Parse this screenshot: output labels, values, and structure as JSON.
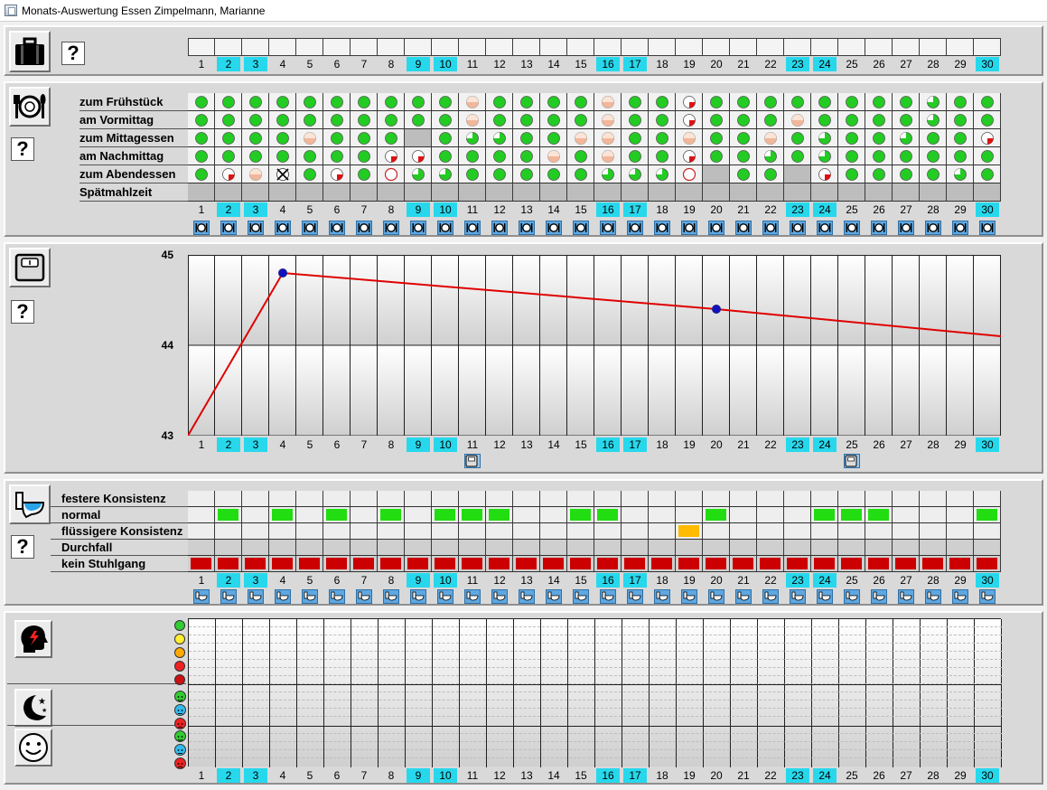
{
  "window": {
    "title": "Monats-Auswertung Essen Zimpelmann, Marianne"
  },
  "help_label": "?",
  "days": [
    1,
    2,
    3,
    4,
    5,
    6,
    7,
    8,
    9,
    10,
    11,
    12,
    13,
    14,
    15,
    16,
    17,
    18,
    19,
    20,
    21,
    22,
    23,
    24,
    25,
    26,
    27,
    28,
    29,
    30
  ],
  "highlight_days": [
    2,
    3,
    9,
    10,
    16,
    17,
    23,
    24,
    30
  ],
  "meals": {
    "rows": [
      "zum Frühstück",
      "am Vormittag",
      "zum Mittagessen",
      "am Nachmittag",
      "zum Abendessen",
      "Spätmahlzeit"
    ],
    "legend": {
      "G": "full",
      "H": "half",
      "Q": "quarter eaten",
      "R": "quarter",
      "O": "none",
      "X": "refused",
      "-": "empty"
    },
    "grid": [
      [
        "G",
        "G",
        "G",
        "G",
        "G",
        "G",
        "G",
        "G",
        "G",
        "G",
        "H",
        "G",
        "G",
        "G",
        "G",
        "H",
        "G",
        "G",
        "R",
        "G",
        "G",
        "G",
        "G",
        "G",
        "G",
        "G",
        "G",
        "T",
        "G",
        "G"
      ],
      [
        "G",
        "G",
        "G",
        "G",
        "G",
        "G",
        "G",
        "G",
        "G",
        "G",
        "H",
        "G",
        "G",
        "G",
        "G",
        "H",
        "G",
        "G",
        "R",
        "G",
        "G",
        "G",
        "H",
        "G",
        "G",
        "G",
        "G",
        "T",
        "G",
        "G"
      ],
      [
        "G",
        "G",
        "G",
        "G",
        "H",
        "G",
        "G",
        "G",
        "-",
        "G",
        "T",
        "T",
        "G",
        "G",
        "H",
        "H",
        "G",
        "G",
        "H",
        "G",
        "G",
        "H",
        "G",
        "T",
        "G",
        "G",
        "T",
        "G",
        "G",
        "R"
      ],
      [
        "G",
        "G",
        "G",
        "G",
        "G",
        "G",
        "G",
        "R",
        "R",
        "G",
        "G",
        "G",
        "G",
        "H",
        "G",
        "H",
        "G",
        "G",
        "R",
        "G",
        "G",
        "T",
        "G",
        "T",
        "G",
        "G",
        "G",
        "G",
        "G",
        "G"
      ],
      [
        "G",
        "R",
        "H",
        "X",
        "G",
        "R",
        "G",
        "O",
        "T",
        "T",
        "G",
        "G",
        "G",
        "G",
        "G",
        "T",
        "T",
        "T",
        "O",
        "-",
        "G",
        "G",
        "-",
        "R",
        "G",
        "G",
        "G",
        "G",
        "T",
        "G"
      ],
      [
        "-",
        "-",
        "-",
        "-",
        "-",
        "-",
        "-",
        "-",
        "-",
        "-",
        "-",
        "-",
        "-",
        "-",
        "-",
        "-",
        "-",
        "-",
        "-",
        "-",
        "-",
        "-",
        "-",
        "-",
        "-",
        "-",
        "-",
        "-",
        "-",
        "-"
      ]
    ]
  },
  "weight": {
    "chart_data": {
      "type": "line",
      "x": [
        1,
        4,
        20,
        30
      ],
      "series": [
        {
          "values": [
            43.0,
            44.8,
            44.4,
            44.1
          ]
        }
      ],
      "measured_days": [
        4,
        20
      ],
      "ylim": [
        43,
        45
      ],
      "yticks": [
        45,
        44,
        43
      ],
      "color": "#e00000",
      "marker_color": "#1010c0"
    },
    "weigh_buttons": [
      11,
      25
    ]
  },
  "stool": {
    "rows": [
      "festere Konsistenz",
      "normal",
      "flüssigere Konsistenz",
      "Durchfall",
      "kein Stuhlgang"
    ],
    "normal_days": [
      2,
      4,
      6,
      8,
      10,
      11,
      12,
      15,
      16,
      20,
      24,
      25,
      26,
      30
    ],
    "fluid_days": [
      19
    ],
    "none_days": [
      1,
      2,
      3,
      4,
      5,
      6,
      7,
      8,
      9,
      10,
      11,
      12,
      13,
      14,
      15,
      16,
      17,
      18,
      19,
      20,
      21,
      22,
      23,
      24,
      25,
      26,
      27,
      28,
      29,
      30
    ],
    "colors": {
      "normal": "#22dd11",
      "fluid": "#ffbb00",
      "none": "#cc0000"
    }
  },
  "status": {
    "pain_colors": [
      "#33cc33",
      "#ffee33",
      "#ffaa00",
      "#ee2222",
      "#cc1111"
    ],
    "face_colors": [
      "#33cc33",
      "#33bbee",
      "#ee2222"
    ]
  }
}
